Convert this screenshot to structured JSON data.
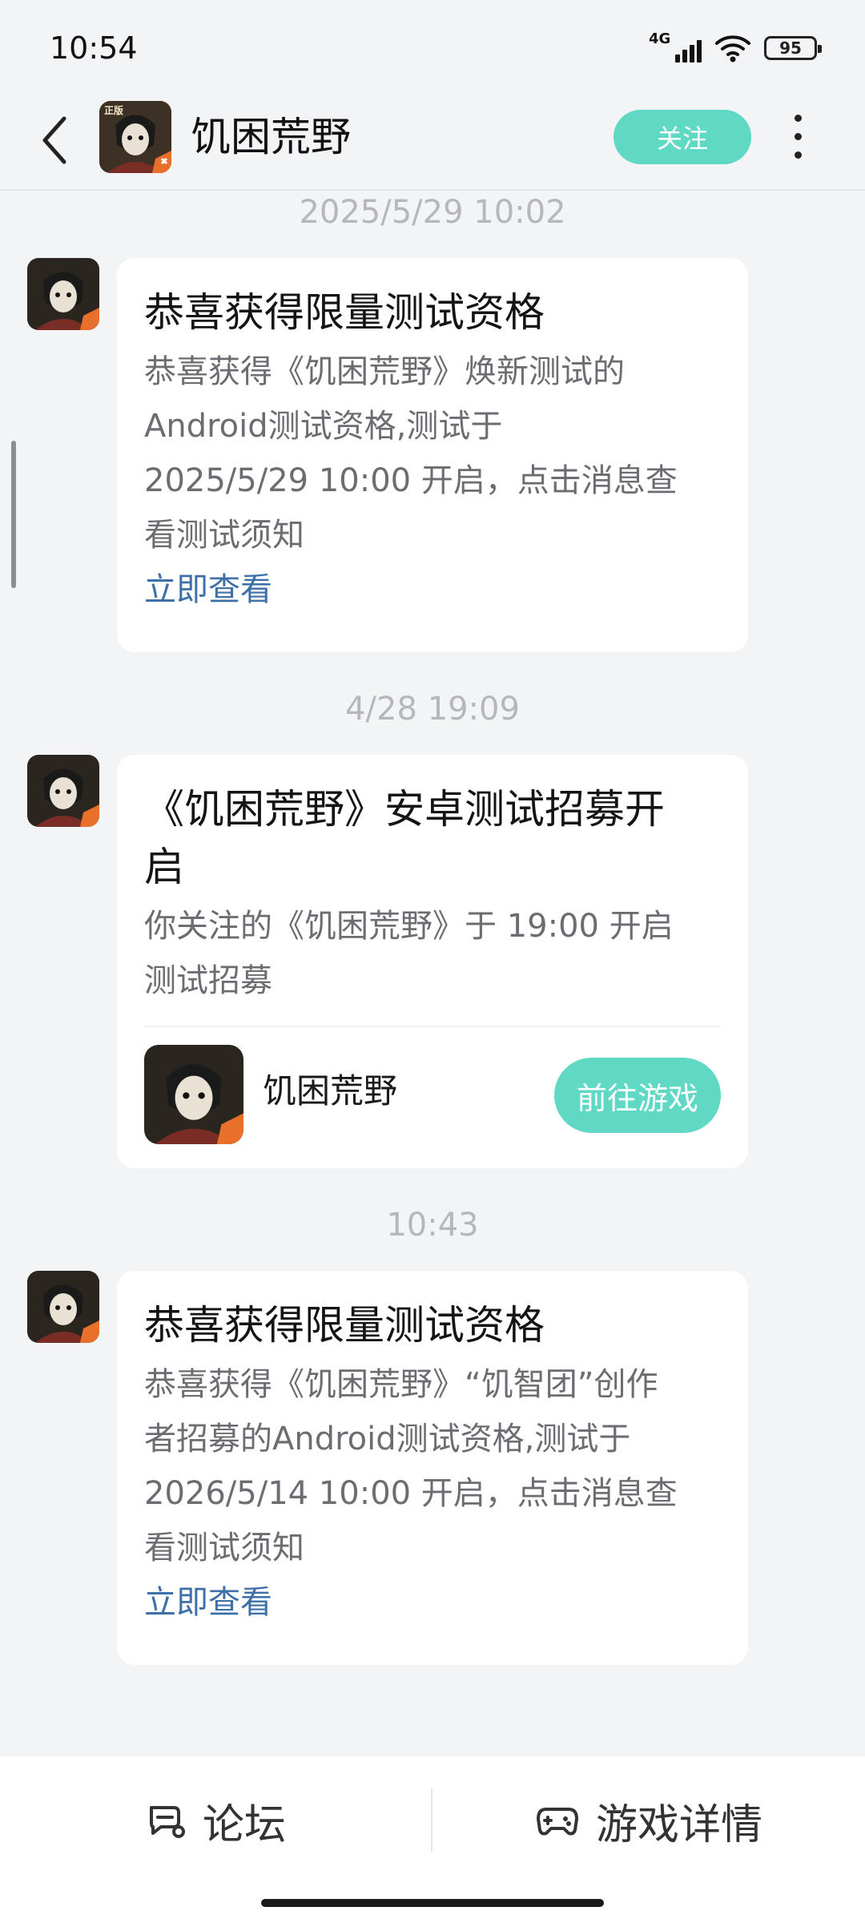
{
  "status_bar": {
    "time": "10:54",
    "network": "4G",
    "battery": "95"
  },
  "header": {
    "title": "饥困荒野",
    "follow_label": "关注"
  },
  "messages": [
    {
      "timestamp": "2025/5/29  10:02",
      "title": "恭喜获得限量测试资格",
      "body_lines": [
        "恭喜获得《饥困荒野》焕新测试的",
        "Android测试资格,测试于",
        "2025/5/29 10:00 开启，点击消息查",
        "看测试须知"
      ],
      "link": "立即查看"
    },
    {
      "timestamp": "4/28  19:09",
      "title_lines": [
        "《饥困荒野》安卓测试招募开",
        "启"
      ],
      "body_lines": [
        "你关注的《饥困荒野》于 19:00 开启",
        "测试招募"
      ],
      "game_name": "饥困荒野",
      "game_button": "前往游戏"
    },
    {
      "timestamp": "10:43",
      "title": "恭喜获得限量测试资格",
      "body_lines": [
        "恭喜获得《饥困荒野》“饥智团”创作",
        "者招募的Android测试资格,测试于",
        "2026/5/14 10:00 开启，点击消息查",
        "看测试须知"
      ],
      "link": "立即查看"
    }
  ],
  "bottom_bar": {
    "forum_label": "论坛",
    "details_label": "游戏详情"
  },
  "colors": {
    "accent": "#5fd8c4",
    "link": "#3f6fa8",
    "background": "#f3f4f6"
  },
  "icons": [
    "back-arrow-icon",
    "more-icon",
    "wifi-icon",
    "signal-icon",
    "battery-icon",
    "forum-chat-icon",
    "gamepad-icon"
  ]
}
